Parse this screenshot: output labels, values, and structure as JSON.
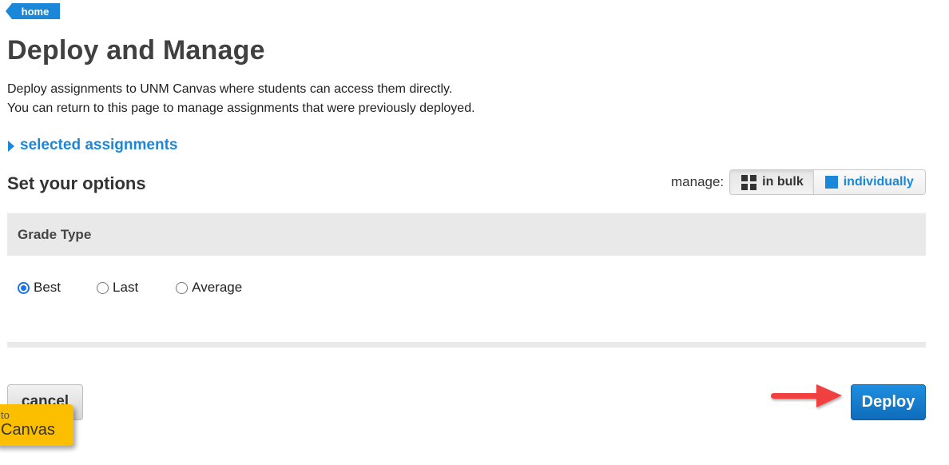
{
  "breadcrumb": {
    "home_label": "home"
  },
  "header": {
    "title": "Deploy and Manage",
    "intro_lines": [
      "Deploy assignments to UNM Canvas where students can access them directly.",
      "You can return to this page to manage assignments that were previously deployed."
    ]
  },
  "selected_assignments": {
    "label": "selected assignments",
    "expanded": false
  },
  "options": {
    "title": "Set your options",
    "manage_label": "manage:",
    "manage_modes": [
      {
        "label": "in bulk",
        "icon": "grid-icon",
        "active": true
      },
      {
        "label": "individually",
        "icon": "square-icon",
        "active": false
      }
    ]
  },
  "grade_type": {
    "header": "Grade Type",
    "options": [
      {
        "label": "Best",
        "checked": true
      },
      {
        "label": "Last",
        "checked": false
      },
      {
        "label": "Average",
        "checked": false
      }
    ]
  },
  "actions": {
    "cancel_label": "cancel",
    "deploy_label": "Deploy"
  },
  "canvas_tab": {
    "small_label": "to",
    "big_label": "Canvas"
  },
  "colors": {
    "accent": "#1b87d9",
    "tab_yellow": "#fbbf00",
    "arrow_red": "#f0413f",
    "header_gray": "#e9e9e9"
  }
}
